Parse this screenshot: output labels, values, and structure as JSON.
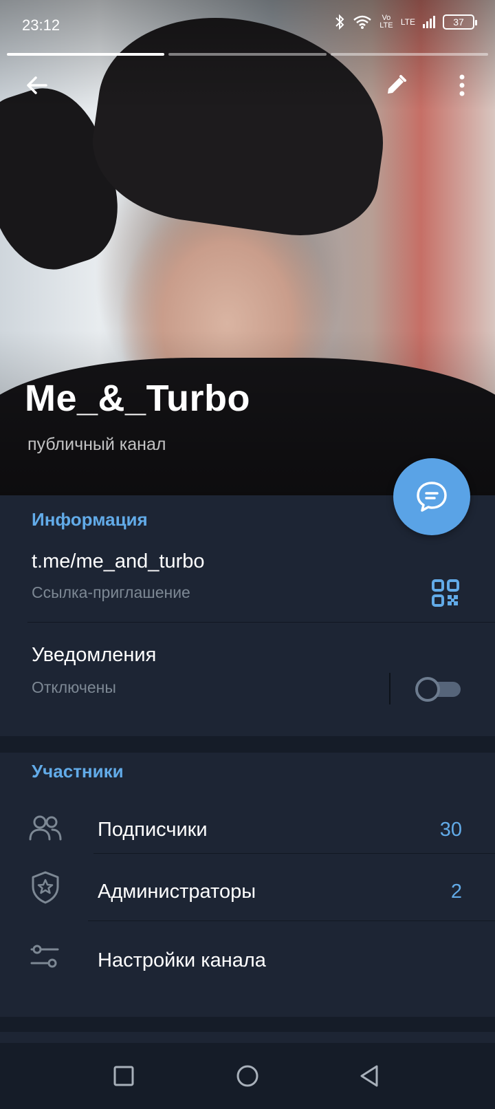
{
  "status_bar": {
    "time": "23:12",
    "volte": "Vo LTE",
    "lte": "LTE",
    "battery": "37"
  },
  "story": {
    "segments": 3,
    "active_index": 0
  },
  "header": {
    "channel_name": "Me_&_Turbo",
    "channel_type": "публичный канал",
    "back_icon": "arrow-left-icon",
    "edit_icon": "pencil-icon",
    "menu_icon": "more-vertical-icon",
    "fab_icon": "chat-bubble-icon"
  },
  "info": {
    "section_title": "Информация",
    "link": "t.me/me_and_turbo",
    "link_caption": "Ссылка-приглашение",
    "qr_icon": "qr-code-icon",
    "notifications_label": "Уведомления",
    "notifications_state": "Отключены",
    "notifications_enabled": false
  },
  "members": {
    "section_title": "Участники",
    "items": [
      {
        "label": "Подписчики",
        "count": "30",
        "icon": "users-icon"
      },
      {
        "label": "Администраторы",
        "count": "2",
        "icon": "shield-star-icon"
      },
      {
        "label": "Настройки канала",
        "count": "",
        "icon": "sliders-icon"
      }
    ]
  },
  "navbar": {
    "recents_icon": "square-icon",
    "home_icon": "circle-icon",
    "back_icon": "triangle-back-icon"
  },
  "colors": {
    "accent": "#62abe8",
    "fab": "#5aa3e6",
    "section_bg": "#1d2534",
    "page_bg": "#151c28"
  }
}
